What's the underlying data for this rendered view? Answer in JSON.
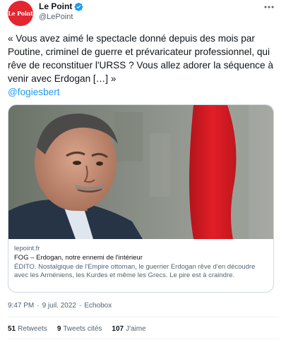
{
  "account": {
    "display_name": "Le Point",
    "handle": "@LePoint",
    "avatar_text": "Le Point",
    "verified": true
  },
  "tweet": {
    "text": "« Vous avez aimé le spectacle donné depuis des mois par Poutine, criminel de guerre et prévaricateur professionnel, qui rêve de reconstituer l'URSS ? Vous allez adorer la séquence à venir avec Erdogan […] »",
    "mention": "@fogiesbert"
  },
  "card": {
    "domain": "lepoint.fr",
    "title": "FOG – Erdogan, notre ennemi de l'intérieur",
    "description": "ÉDITO. Nostalgique de l'Empire ottoman, le guerrier Erdogan rêve d'en découdre avec les Arméniens, les Kurdes et même les Grecs. Le pire est à craindre."
  },
  "meta": {
    "time": "9:47 PM",
    "separator": "·",
    "date": "9 juil. 2022",
    "source": "Echobox"
  },
  "stats": {
    "retweets_count": "51",
    "retweets_label": "Retweets",
    "quotes_count": "9",
    "quotes_label": "Tweets cités",
    "likes_count": "107",
    "likes_label": "J'aime"
  },
  "colors": {
    "brand": "#e3262f",
    "link": "#1d9bf0",
    "secondary_text": "#536471",
    "border": "#cfd9de"
  }
}
